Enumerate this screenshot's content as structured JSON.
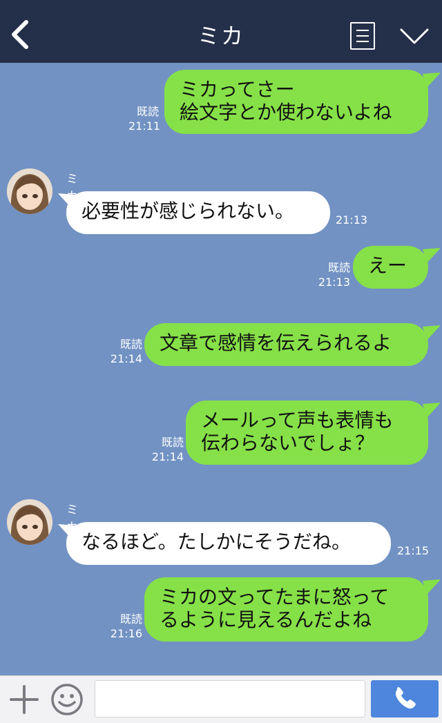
{
  "header": {
    "title": "ミカ",
    "back_icon": "back-chevron-icon",
    "menu_icon": "list-menu-icon",
    "collapse_icon": "chevron-down-icon"
  },
  "colors": {
    "header_bg": "#24304a",
    "chat_bg": "#7292c3",
    "outgoing_bubble": "#86e048",
    "incoming_bubble": "#ffffff",
    "send_button": "#4d86dc"
  },
  "messages": [
    {
      "dir": "out",
      "text": "ミカってさー\n絵文字とか使わないよね",
      "read": "既読",
      "time": "21:11"
    },
    {
      "dir": "in",
      "sender": "ミカ",
      "text": "必要性が感じられない。",
      "time": "21:13"
    },
    {
      "dir": "out",
      "text": "えー",
      "read": "既読",
      "time": "21:13"
    },
    {
      "dir": "out",
      "text": "文章で感情を伝えられるよ",
      "read": "既読",
      "time": "21:14"
    },
    {
      "dir": "out",
      "text": "メールって声も表情も\n伝わらないでしょ？",
      "read": "既読",
      "time": "21:14"
    },
    {
      "dir": "in",
      "sender": "ミカ",
      "text": "なるほど。たしかにそうだね。",
      "time": "21:15"
    },
    {
      "dir": "out",
      "text": "ミカの文ってたまに怒って\nるように見えるんだよね",
      "read": "既読",
      "time": "21:16"
    }
  ],
  "footer": {
    "input_value": "",
    "plus_icon": "plus-icon",
    "emoji_icon": "smiley-icon",
    "call_icon": "phone-icon"
  }
}
